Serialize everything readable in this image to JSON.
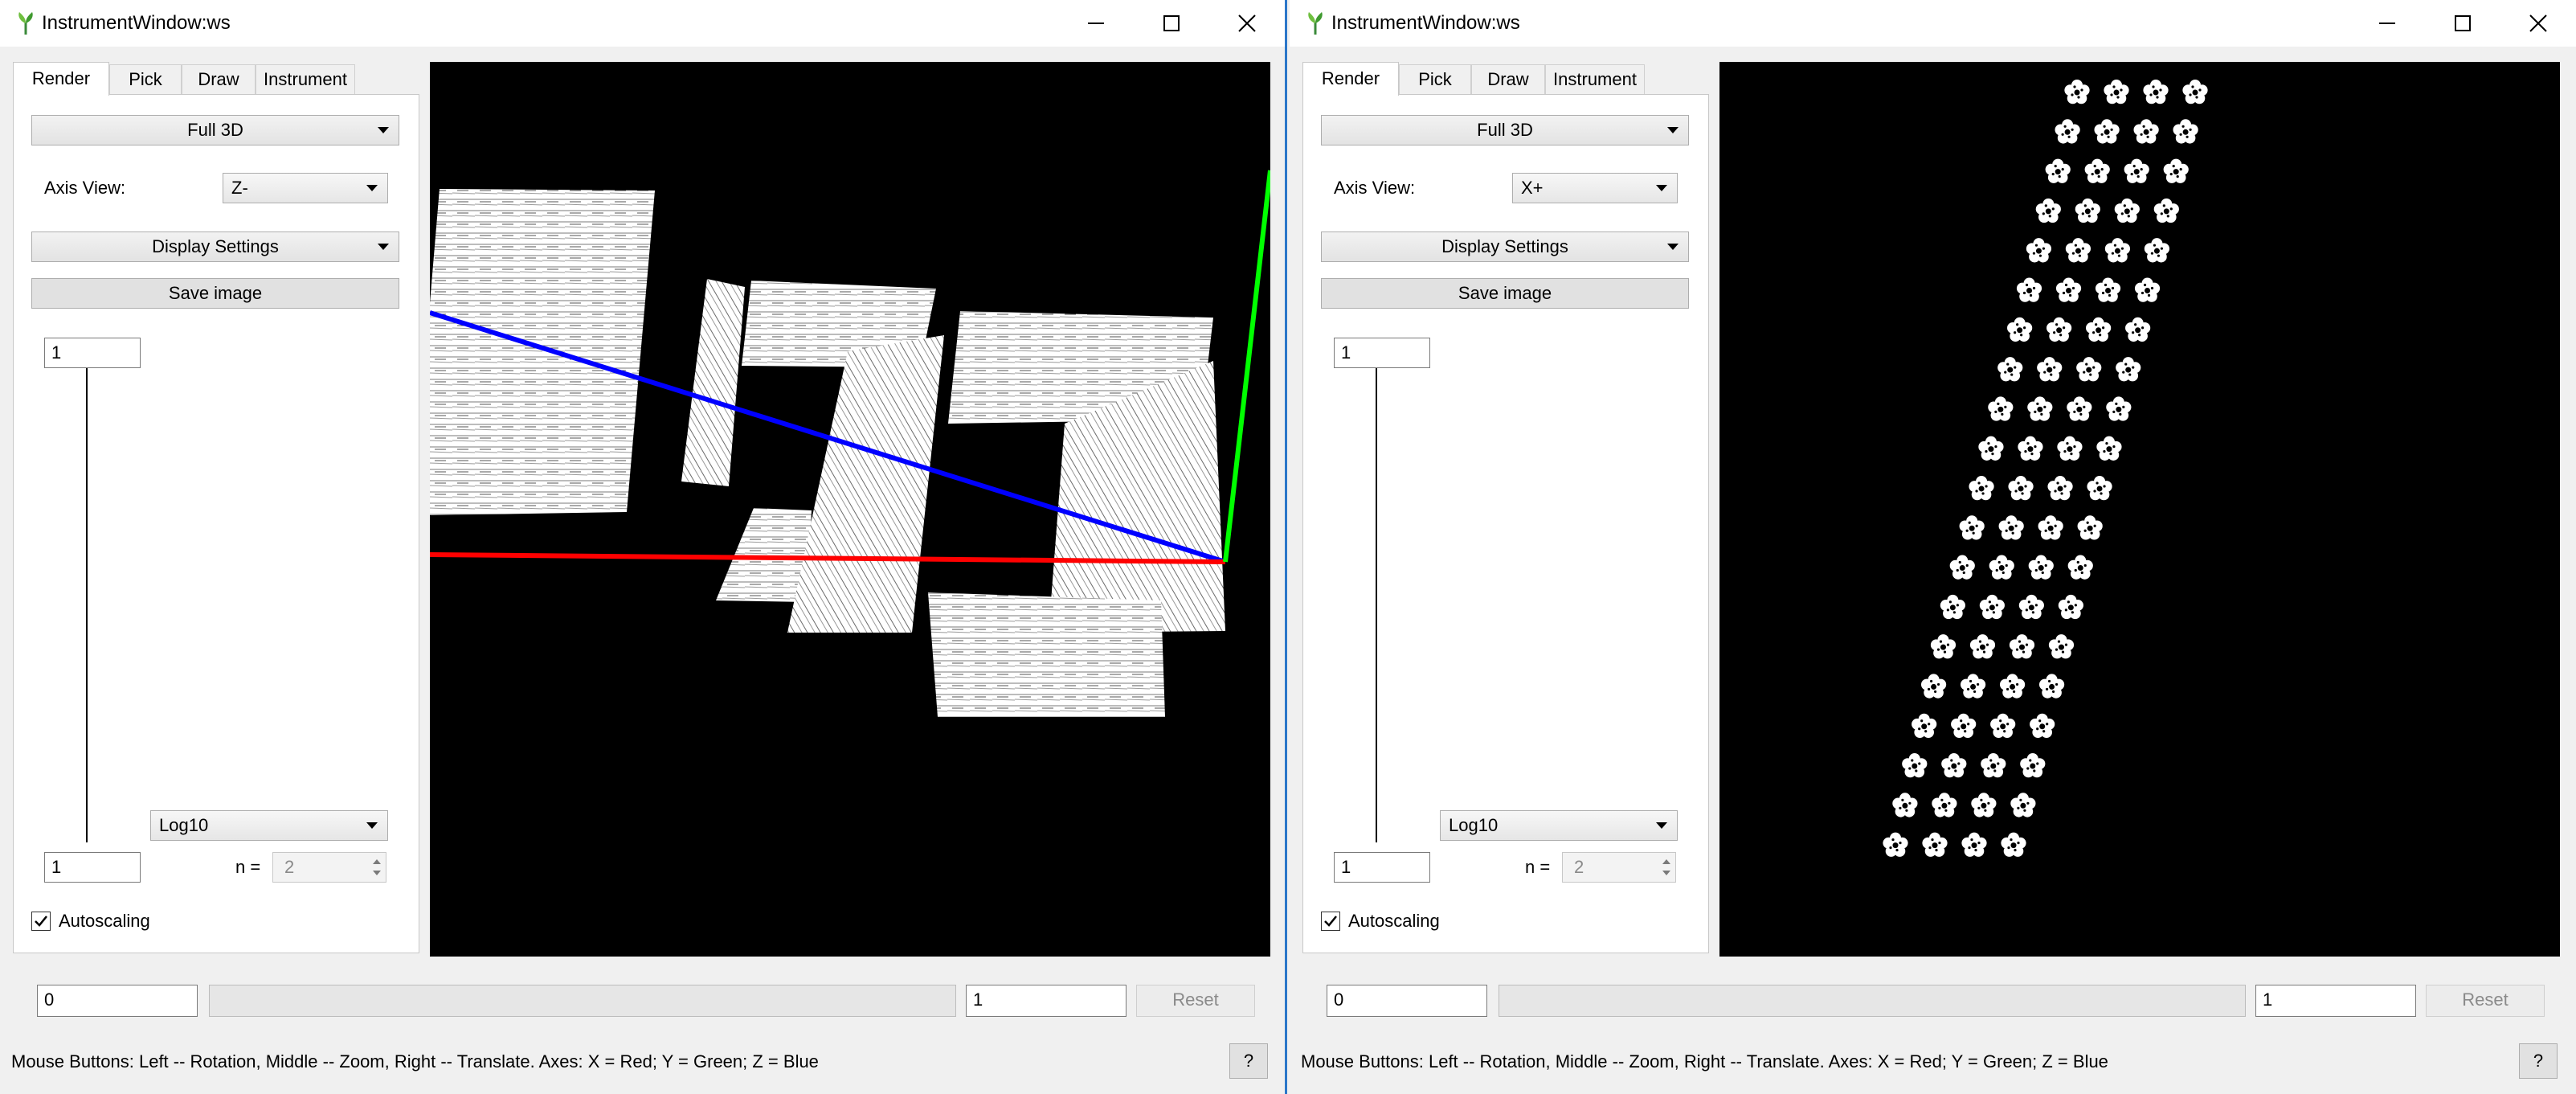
{
  "windows": [
    {
      "title": "InstrumentWindow:ws",
      "tabs": [
        "Render",
        "Pick",
        "Draw",
        "Instrument"
      ],
      "active_tab": "Render",
      "render_mode": "Full 3D",
      "axis_view_label": "Axis View:",
      "axis_view_value": "Z-",
      "display_settings_label": "Display Settings",
      "save_image_label": "Save image",
      "colormap_max": "1",
      "colormap_min": "1",
      "scale_type": "Log10",
      "n_label": "n =",
      "n_value": "2",
      "autoscaling_label": "Autoscaling",
      "autoscaling_checked": true,
      "range_min": "0",
      "range_max": "1",
      "reset_label": "Reset",
      "status_text": "Mouse Buttons: Left -- Rotation, Middle -- Zoom, Right -- Translate. Axes: X = Red; Y = Green; Z = Blue",
      "help_label": "?"
    },
    {
      "title": "InstrumentWindow:ws",
      "tabs": [
        "Render",
        "Pick",
        "Draw",
        "Instrument"
      ],
      "active_tab": "Render",
      "render_mode": "Full 3D",
      "axis_view_label": "Axis View:",
      "axis_view_value": "X+",
      "display_settings_label": "Display Settings",
      "save_image_label": "Save image",
      "colormap_max": "1",
      "colormap_min": "1",
      "scale_type": "Log10",
      "n_label": "n =",
      "n_value": "2",
      "autoscaling_label": "Autoscaling",
      "autoscaling_checked": true,
      "range_min": "0",
      "range_max": "1",
      "reset_label": "Reset",
      "status_text": "Mouse Buttons: Left -- Rotation, Middle -- Zoom, Right -- Translate. Axes: X = Red; Y = Green; Z = Blue",
      "help_label": "?"
    }
  ],
  "colors": {
    "x_axis": "#ff0000",
    "y_axis": "#00ff00",
    "z_axis": "#0000ff",
    "viewport_bg": "#000000",
    "detector": "#ffffff",
    "window_border": "#2b77c9"
  },
  "icons": [
    "app-logo-icon",
    "minimize-icon",
    "maximize-icon",
    "close-icon",
    "dropdown-arrow-icon",
    "spin-up-icon",
    "spin-down-icon",
    "checkmark-icon"
  ]
}
